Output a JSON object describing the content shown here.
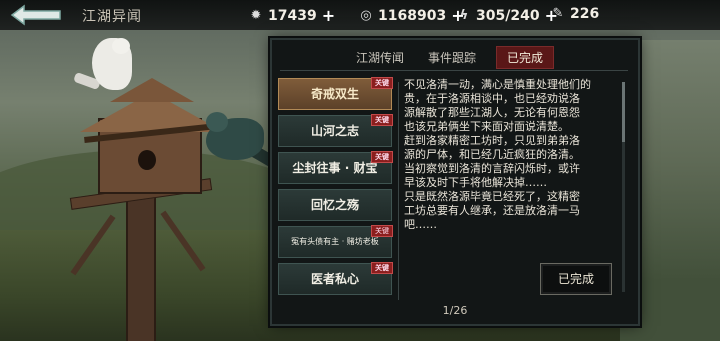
{
  "header": {
    "title": "江湖异闻",
    "back_icon": "back-arrow-icon",
    "resources": [
      {
        "icon": "coin-icon",
        "value": "17439"
      },
      {
        "icon": "copper-coin-icon",
        "value": "1168903"
      },
      {
        "icon": "energy-icon",
        "value": "305/240"
      },
      {
        "icon": "scroll-icon",
        "value": "226"
      }
    ]
  },
  "tabs": [
    {
      "label": "江湖传闻",
      "active": false
    },
    {
      "label": "事件跟踪",
      "active": false
    },
    {
      "label": "已完成",
      "active": true
    }
  ],
  "quests": [
    {
      "title": "奇戒双生",
      "badge": "关键",
      "active": true
    },
    {
      "title": "山河之志",
      "badge": "关键",
      "active": false
    },
    {
      "title": "尘封往事 · 财宝",
      "badge": "关键",
      "active": false
    },
    {
      "title": "回忆之殇",
      "badge": "",
      "active": false
    },
    {
      "title": "冤有头债有主 · 赌坊老板",
      "badge": "关键",
      "active": false
    },
    {
      "title": "医者私心",
      "badge": "关键",
      "active": false
    }
  ],
  "story": {
    "text": "不见洛清一动，满心是慎重处理他们的\n贵，在于洛源相谈中，也已经劝说洛\n源解散了那些江湖人，无论有何恩怨\n也该兄弟俩坐下来面对面说清楚。\n赶到洛家精密工坊时，只见到弟弟洛\n源的尸体，和已经几近疯狂的洛清。\n当初察觉到洛清的言辞闪烁时，或许\n早该及时下手将他解决掉……\n只是既然洛源毕竟已经死了，这精密\n工坊总要有人继承，还是放洛清一马\n吧……"
  },
  "completed_label": "已完成",
  "pagination": "1/26",
  "colors": {
    "active_tab": "#5a1717",
    "active_item": "#7f5c3a",
    "key_badge": "#8b1e1e"
  }
}
